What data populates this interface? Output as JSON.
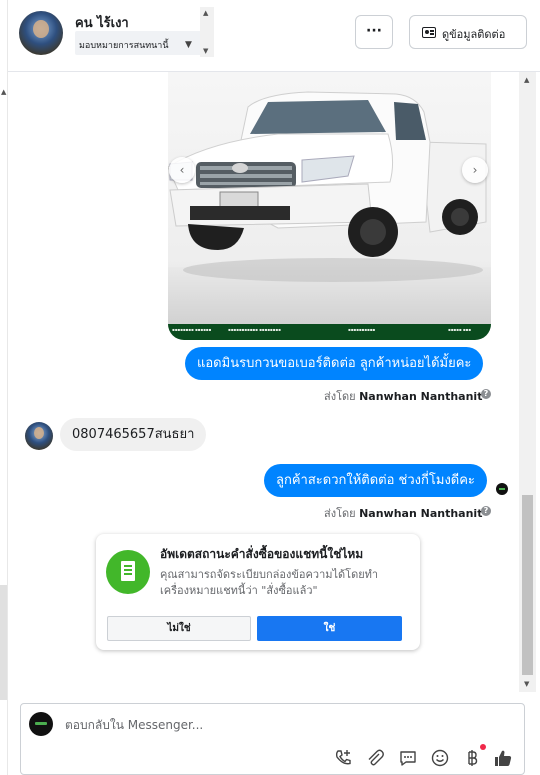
{
  "header": {
    "contact_name": "คน ไร้เงา",
    "assign_label": "มอบหมายการสนทนานี้",
    "more_button_label": "···",
    "view_info_label": "ดูข้อมูลติดต่อ"
  },
  "messages": [
    {
      "direction": "outgoing",
      "text": "แอดมินรบกวนขอเบอร์ติดต่อ ลูกค้าหน่อยได้มั้ยคะ"
    },
    {
      "direction": "incoming",
      "text": "0807465657สนธยา"
    },
    {
      "direction": "outgoing",
      "text": "ลูกค้าสะดวกให้ติดต่อ ช่วงกี่โมงดีคะ"
    }
  ],
  "sent_by": {
    "prefix": "ส่งโดย",
    "name": "Nanwhan Nanthanit"
  },
  "order_card": {
    "title": "อัพเดตสถานะคำสั่งซื้อของแชทนี้ใช่ไหม",
    "description": "คุณสามารถจัดระเบียบกล่องข้อความได้โดยทำเครื่องหมายแชทนี้ว่า \"สั่งซื้อแล้ว\"",
    "no_label": "ไม่ใช่",
    "yes_label": "ใช่"
  },
  "composer": {
    "placeholder": "ตอบกลับใน Messenger..."
  },
  "colors": {
    "outgoing_bubble": "#0084ff",
    "incoming_bubble": "#f0f0f0",
    "primary_button": "#1877f2",
    "order_icon": "#42b72a"
  }
}
